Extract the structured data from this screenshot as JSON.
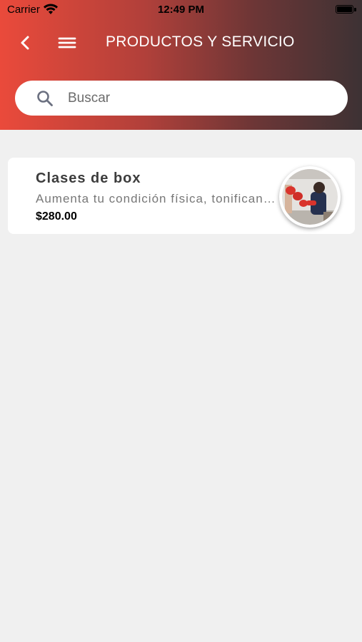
{
  "status_bar": {
    "carrier": "Carrier",
    "time": "12:49 PM"
  },
  "nav": {
    "back_icon": "chevron-left-icon",
    "menu_icon": "hamburger-menu-icon",
    "title": "PRODUCTOS Y SERVICIO"
  },
  "search": {
    "icon": "search-icon",
    "placeholder": "Buscar",
    "value": ""
  },
  "products": [
    {
      "title": "Clases de box",
      "description": "Aumenta tu condición física, tonificando tu cuerpo",
      "price": "$280.00",
      "image": "boxing-class-photo"
    }
  ],
  "colors": {
    "header_gradient_start": "#ea4a3b",
    "header_gradient_end": "#3d3234",
    "background": "#f0f0f0",
    "card": "#ffffff"
  }
}
